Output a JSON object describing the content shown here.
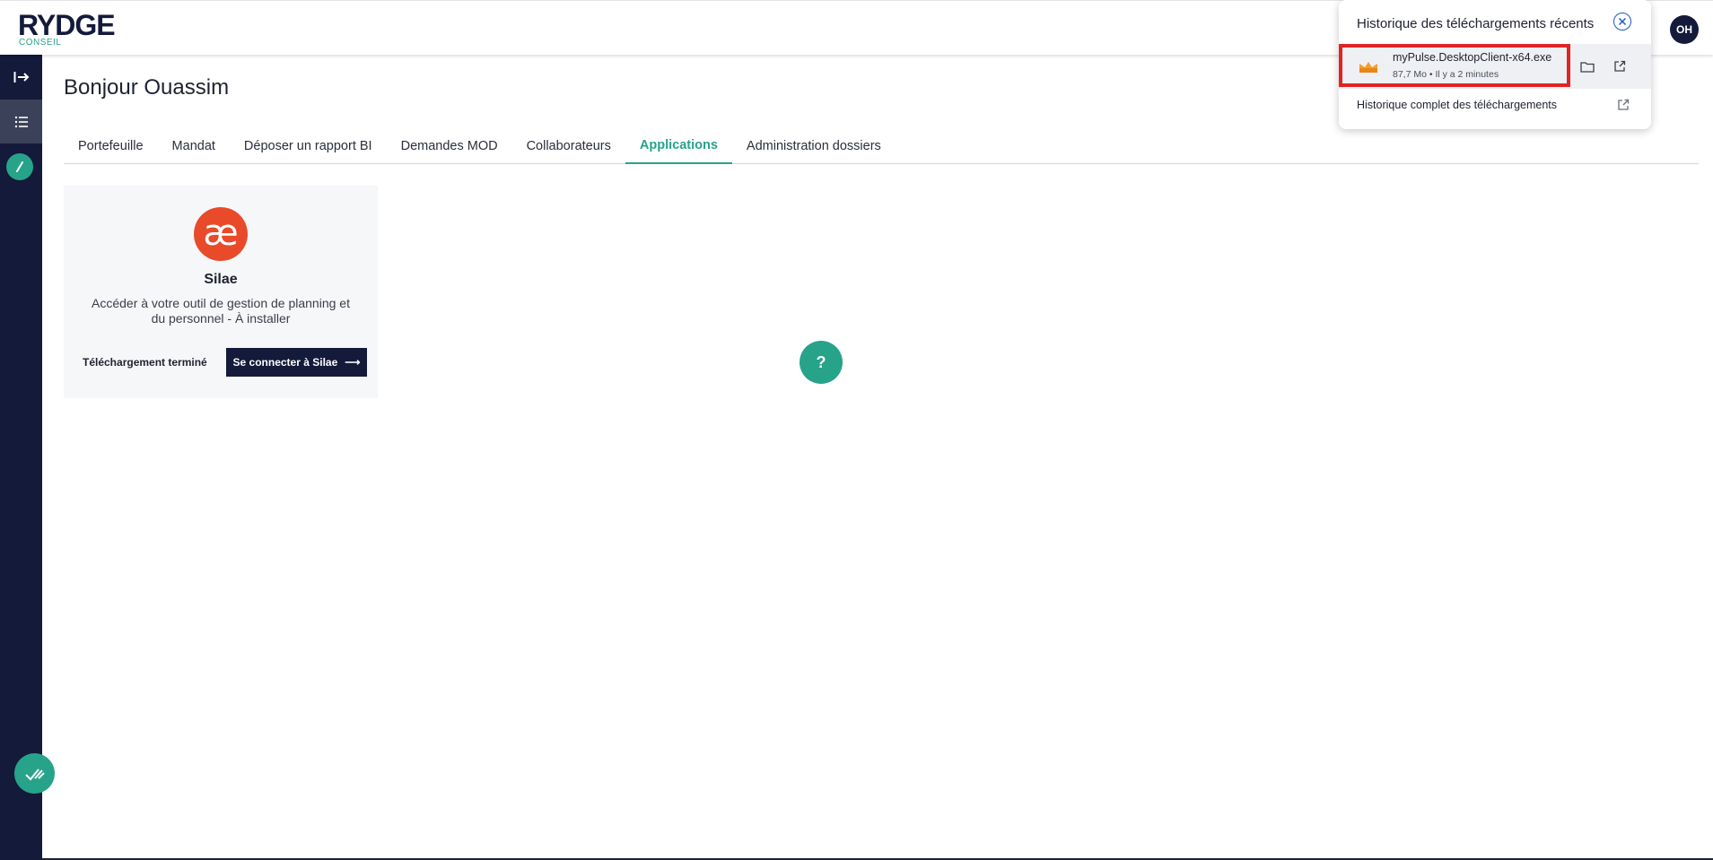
{
  "header": {
    "logo_text": "RYDGE",
    "logo_sub": "CONSEIL",
    "avatar_initials": "OH"
  },
  "sidebar": {
    "items": [
      {
        "icon": "expand-arrow-icon"
      },
      {
        "icon": "list-icon",
        "active": true
      },
      {
        "icon": "pen-icon"
      }
    ],
    "bottom_icon": "check-icon"
  },
  "main": {
    "greeting": "Bonjour Ouassim",
    "tabs": [
      {
        "label": "Portefeuille"
      },
      {
        "label": "Mandat"
      },
      {
        "label": "Déposer un rapport BI"
      },
      {
        "label": "Demandes MOD"
      },
      {
        "label": "Collaborateurs"
      },
      {
        "label": "Applications",
        "active": true
      },
      {
        "label": "Administration dossiers"
      }
    ],
    "app_card": {
      "logo_glyph": "æ",
      "name": "Silae",
      "description": "Accéder à votre outil de gestion de planning et du personnel - À installer",
      "status": "Téléchargement terminé",
      "button_label": "Se connecter à Silae",
      "button_arrow": "⟶"
    },
    "help_label": "?"
  },
  "download_popup": {
    "title": "Historique des téléchargements récents",
    "file_name": "myPulse.DesktopClient-x64.exe",
    "file_meta": "87,7 Mo • Il y a 2 minutes",
    "full_history_label": "Historique complet des téléchargements"
  },
  "colors": {
    "navy": "#131a3a",
    "accent_green": "#27a38a",
    "silae_red": "#e84a2a",
    "highlight_red": "#e02424"
  }
}
